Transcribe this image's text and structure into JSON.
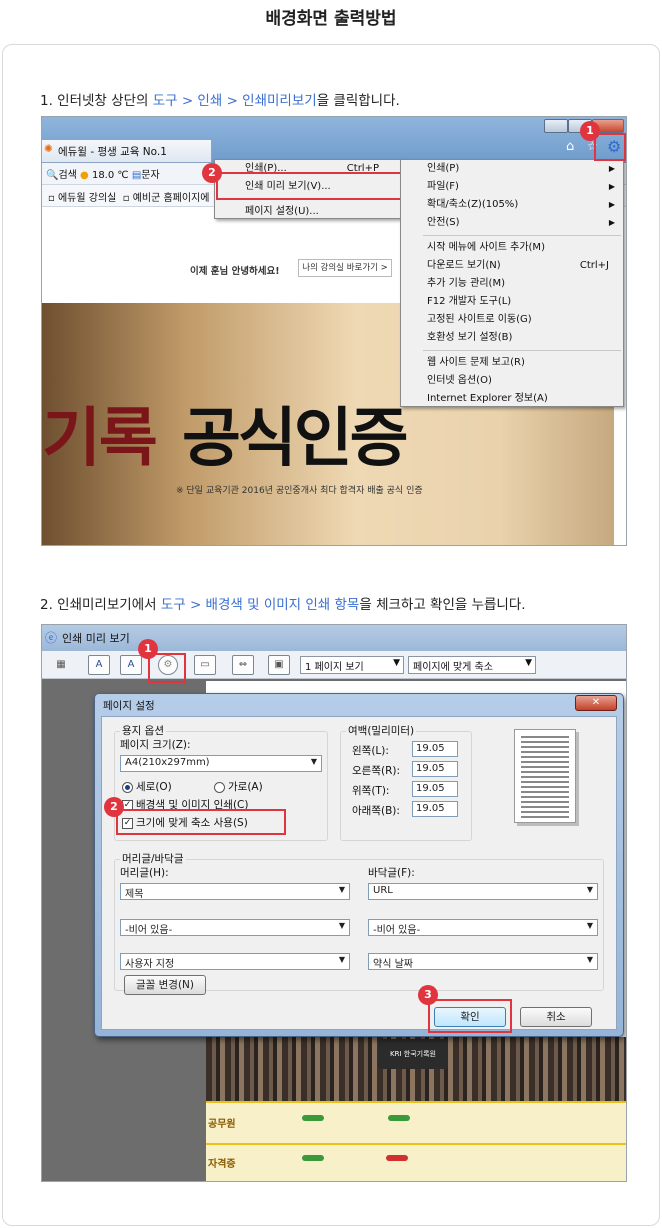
{
  "page_title": "배경화면 출력방법",
  "step1": {
    "prefix": "1. 인터넷창 상단의 ",
    "highlight": "도구 > 인쇄 > 인쇄미리보기",
    "suffix": "을 클릭합니다."
  },
  "step2": {
    "prefix": "2. 인쇄미리보기에서 ",
    "highlight": "도구 > 배경색 및 이미지 인쇄 항목",
    "suffix": "을 체크하고 확인을 누릅니다."
  },
  "shot1": {
    "tab_title": "에듀윌 - 평생 교육 No.1",
    "toolbar": {
      "search": "검색",
      "weather": "18.0 ℃",
      "text": "문자"
    },
    "favorites": {
      "item1": "에듀윌 강의실",
      "item2": "예비군 홈페이지에"
    },
    "greeting": "이제 훈님 안녕하세요!",
    "greeting_button": "나의 강의실 바로가기 >",
    "hero_red": "기록",
    "hero_black": "공식인증",
    "hero_sub": "※ 단일 교육기관 2016년 공인중개사 최다 합격자 배출 공식 인증",
    "print_submenu": [
      {
        "label": "인쇄(P)...",
        "key": "Ctrl+P"
      },
      {
        "label": "인쇄 미리 보기(V)...",
        "key": ""
      },
      {
        "label": "페이지 설정(U)...",
        "key": ""
      }
    ],
    "tools_menu": {
      "group1": [
        {
          "label": "인쇄(P)",
          "arrow": "▶"
        },
        {
          "label": "파일(F)",
          "arrow": "▶"
        },
        {
          "label": "확대/축소(Z)(105%)",
          "arrow": "▶"
        },
        {
          "label": "안전(S)",
          "arrow": "▶"
        }
      ],
      "group2": [
        {
          "label": "시작 메뉴에 사이트 추가(M)",
          "key": ""
        },
        {
          "label": "다운로드 보기(N)",
          "key": "Ctrl+J"
        },
        {
          "label": "추가 기능 관리(M)",
          "key": ""
        },
        {
          "label": "F12 개발자 도구(L)",
          "key": ""
        },
        {
          "label": "고정된 사이트로 이동(G)",
          "key": ""
        },
        {
          "label": "호환성 보기 설정(B)",
          "key": ""
        }
      ],
      "group3": [
        {
          "label": "웹 사이트 문제 보고(R)"
        },
        {
          "label": "인터넷 옵션(O)"
        },
        {
          "label": "Internet Explorer 정보(A)"
        }
      ]
    },
    "badges": [
      "1",
      "2"
    ]
  },
  "shot2": {
    "window_title": "인쇄 미리 보기",
    "page_view_select": "1 페이지 보기",
    "fit_select": "페이지에 맞게 축소",
    "dialog_title": "페이지 설정",
    "paper_group": "용지 옵션",
    "page_size_label": "페이지 크기(Z):",
    "page_size_value": "A4(210x297mm)",
    "portrait": "세로(O)",
    "landscape": "가로(A)",
    "bg_print": "배경색 및 이미지 인쇄(C)",
    "shrink_fit": "크기에 맞게 축소 사용(S)",
    "margins_group": "여백(밀리미터)",
    "margins": [
      {
        "label": "왼쪽(L):",
        "value": "19.05"
      },
      {
        "label": "오른쪽(R):",
        "value": "19.05"
      },
      {
        "label": "위쪽(T):",
        "value": "19.05"
      },
      {
        "label": "아래쪽(B):",
        "value": "19.05"
      }
    ],
    "header_footer_group": "머리글/바닥글",
    "header_label": "머리글(H):",
    "footer_label": "바닥글(F):",
    "header_values": [
      "제목",
      "-비어 있음-",
      "사용자 지정"
    ],
    "footer_values": [
      "URL",
      "-비어 있음-",
      "약식 날짜"
    ],
    "font_button": "글꼴 변경(N)",
    "ok_button": "확인",
    "cancel_button": "취소",
    "badges": [
      "1",
      "2",
      "3"
    ],
    "bg_categories": [
      "공무원",
      "자격증"
    ],
    "logo_text": "KRI 한국기록원"
  },
  "colors": {
    "accent_red": "#e0353f",
    "link_blue": "#3a6fd0"
  }
}
